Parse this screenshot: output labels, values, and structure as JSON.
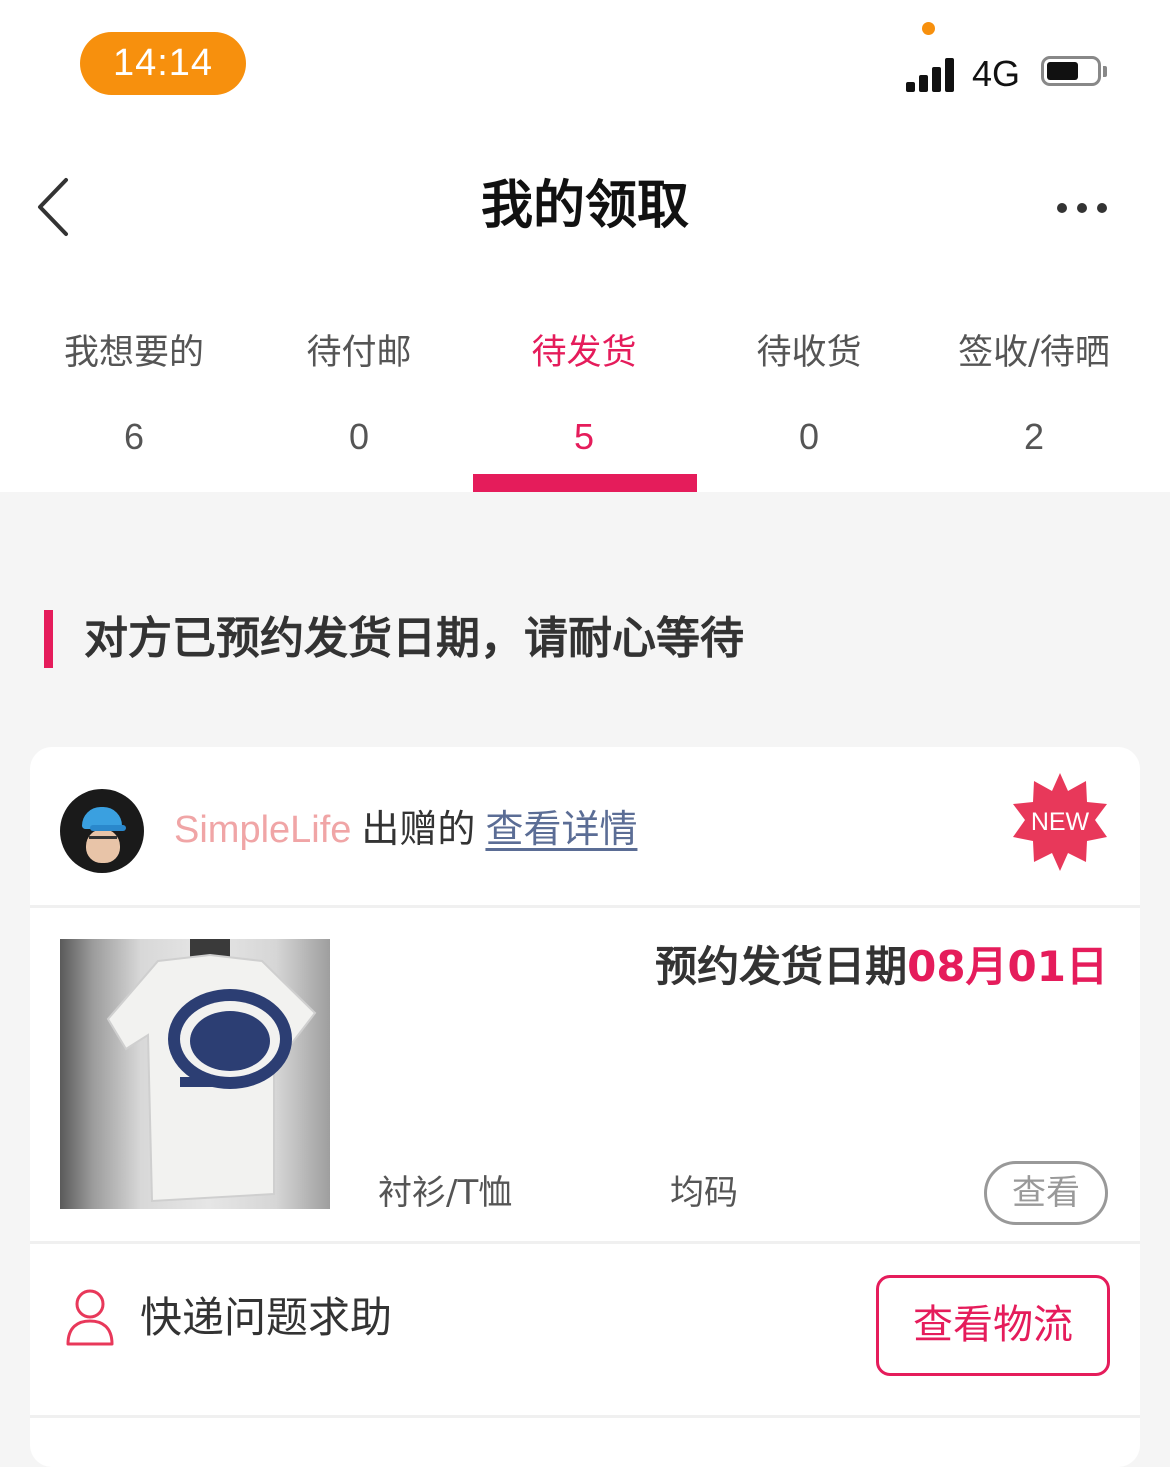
{
  "status_bar": {
    "time": "14:14",
    "network": "4G",
    "icons": [
      "signal-icon",
      "battery-icon"
    ],
    "time_pill_color": "#f7900d"
  },
  "header": {
    "title": "我的领取",
    "back_icon": "chevron-left-icon",
    "more_icon": "more-horizontal-icon"
  },
  "tabs": [
    {
      "label": "我想要的",
      "count": "6",
      "active": false
    },
    {
      "label": "待付邮",
      "count": "0",
      "active": false
    },
    {
      "label": "待发货",
      "count": "5",
      "active": true
    },
    {
      "label": "待收货",
      "count": "0",
      "active": false
    },
    {
      "label": "签收/待晒",
      "count": "2",
      "active": false
    }
  ],
  "section": {
    "heading": "对方已预约发货日期，请耐心等待"
  },
  "card": {
    "giver_name": "SimpleLife",
    "giver_suffix": "出赠的",
    "detail_link": "查看详情",
    "badge": "NEW",
    "ship_date_label": "预约发货日期",
    "ship_date_value": "08月01日",
    "category": "衬衫/T恤",
    "size": "均码",
    "view_button": "查看",
    "help_label": "快递问题求助",
    "logistics_button": "查看物流",
    "product_image": "white-tshirt-photo",
    "avatar": "user-avatar"
  },
  "colors": {
    "accent": "#e51c5b",
    "giver_name": "#f0a5a6",
    "link": "#5b6d95",
    "background": "#f5f5f5",
    "badge": "#e8385a"
  }
}
